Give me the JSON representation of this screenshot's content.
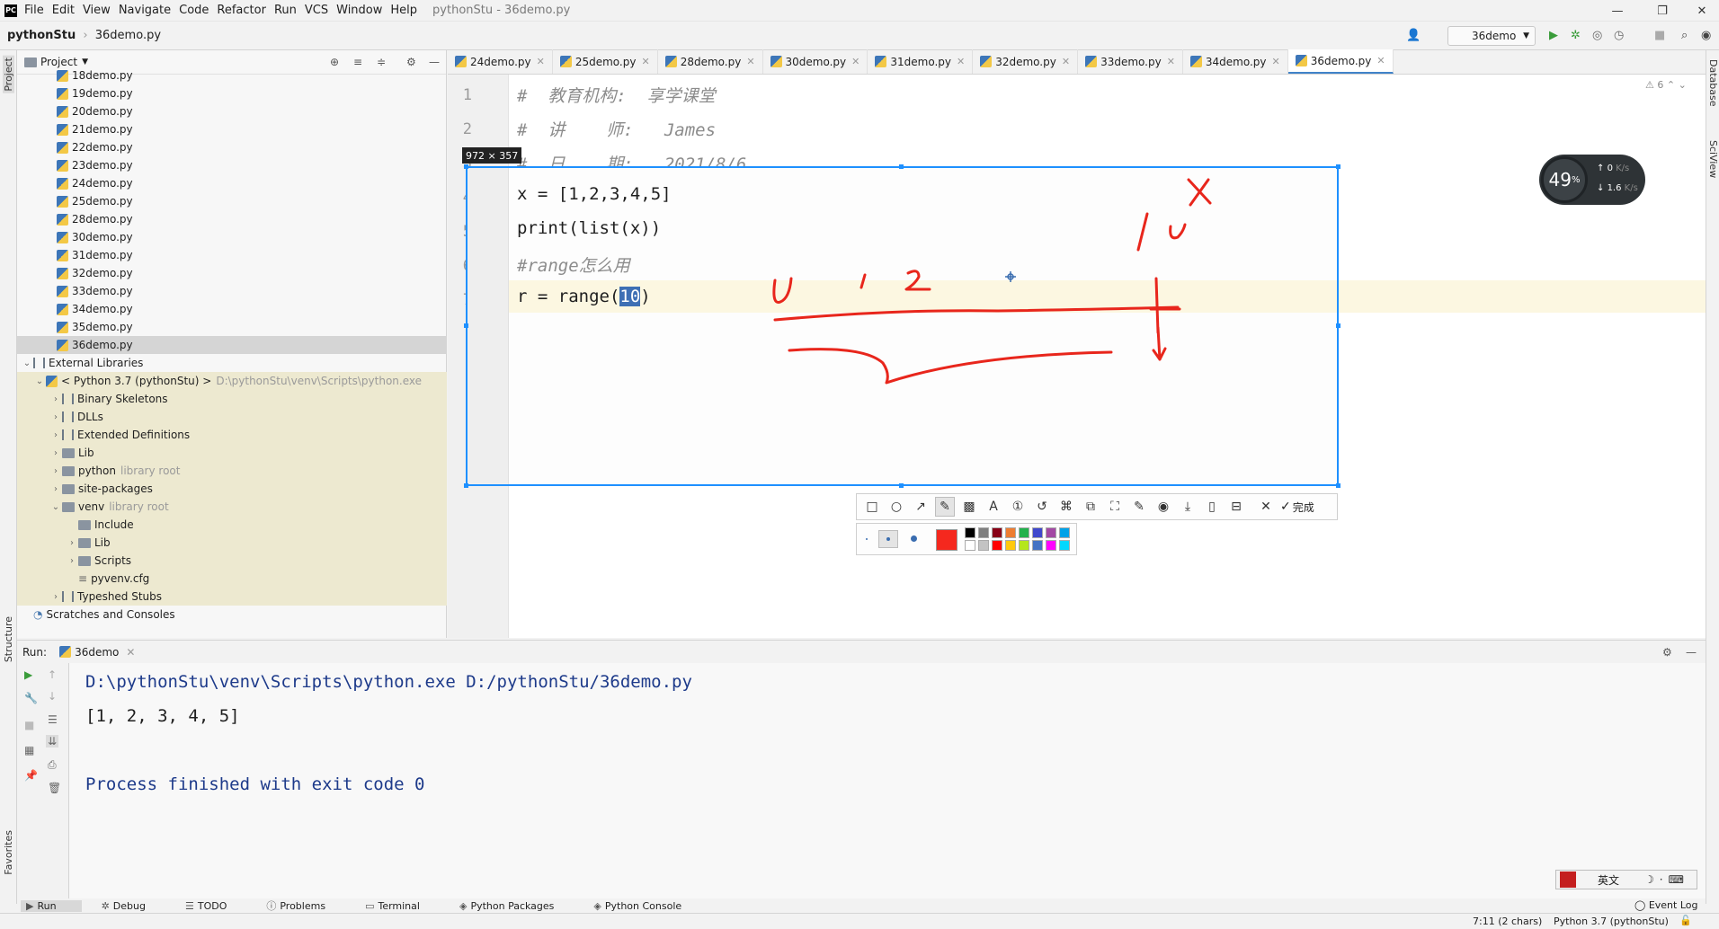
{
  "app": {
    "menu": [
      "File",
      "Edit",
      "View",
      "Navigate",
      "Code",
      "Refactor",
      "Run",
      "VCS",
      "Window",
      "Help"
    ],
    "window_title": "pythonStu - 36demo.py"
  },
  "nav": {
    "project": "pythonStu",
    "file": "36demo.py",
    "run_config": "36demo"
  },
  "project_panel": {
    "title": "Project",
    "files": [
      "18demo.py",
      "19demo.py",
      "20demo.py",
      "21demo.py",
      "22demo.py",
      "23demo.py",
      "24demo.py",
      "25demo.py",
      "28demo.py",
      "30demo.py",
      "31demo.py",
      "32demo.py",
      "33demo.py",
      "34demo.py",
      "35demo.py",
      "36demo.py"
    ],
    "external_libraries": "External Libraries",
    "python_sdk": "< Python 3.7 (pythonStu) >",
    "python_path": "D:\\pythonStu\\venv\\Scripts\\python.exe",
    "libs": [
      {
        "name": "Binary Skeletons",
        "suffix": ""
      },
      {
        "name": "DLLs",
        "suffix": ""
      },
      {
        "name": "Extended Definitions",
        "suffix": ""
      },
      {
        "name": "Lib",
        "suffix": ""
      },
      {
        "name": "python",
        "suffix": "library root"
      },
      {
        "name": "site-packages",
        "suffix": ""
      },
      {
        "name": "venv",
        "suffix": "library root"
      }
    ],
    "venv_children": [
      "Include",
      "Lib",
      "Scripts",
      "pyvenv.cfg"
    ],
    "typeshed": "Typeshed Stubs",
    "scratches": "Scratches and Consoles"
  },
  "tabs": [
    "24demo.py",
    "25demo.py",
    "28demo.py",
    "30demo.py",
    "31demo.py",
    "32demo.py",
    "33demo.py",
    "34demo.py",
    "36demo.py"
  ],
  "editor": {
    "line_numbers": [
      "1",
      "2",
      "3",
      "4",
      "5",
      "6",
      "7"
    ],
    "header_comments": [
      "#  教育机构:  享学课堂",
      "#  讲    师:   James",
      "#  日    期:   2021/8/6"
    ],
    "code": {
      "line4": "x = [1,2,3,4,5]",
      "line5": "print(list(x))",
      "line6": "#range怎么用",
      "line7_prefix": "r = range(",
      "line7_value": "10",
      "line7_suffix": ")"
    },
    "warnings": "6"
  },
  "net_widget": {
    "percent": "49",
    "unit": "%",
    "up": "0",
    "up_unit": "K/s",
    "down": "1.6",
    "down_unit": "K/s"
  },
  "capture": {
    "size_label": "972 × 357",
    "done_label": "完成",
    "selected_color": "#f5281e",
    "palette": [
      "#000000",
      "#7f7f7f",
      "#880015",
      "#ed7d31",
      "#22b14c",
      "#3f48cc",
      "#a349a4",
      "#00a2e8",
      "#ffffff",
      "#c3c3c3",
      "#ff0000",
      "#ffc90e",
      "#b5e61d",
      "#4472c4",
      "#ff00ff",
      "#00d8ff"
    ]
  },
  "run_panel": {
    "label": "Run:",
    "tab": "36demo",
    "lines": [
      "D:\\pythonStu\\venv\\Scripts\\python.exe D:/pythonStu/36demo.py",
      "[1, 2, 3, 4, 5]",
      "",
      "Process finished with exit code 0"
    ]
  },
  "bottom_tabs": [
    "Run",
    "Debug",
    "TODO",
    "Problems",
    "Terminal",
    "Python Packages",
    "Python Console"
  ],
  "event_log": "Event Log",
  "status": {
    "position": "7:11 (2 chars)",
    "interpreter": "Python 3.7 (pythonStu)"
  },
  "side_labels": {
    "left_top": "Project",
    "left_mid": "Structure",
    "left_bot": "Favorites",
    "right_top": "Database",
    "right_mid": "SciView"
  },
  "ime": {
    "mode": "英文"
  }
}
